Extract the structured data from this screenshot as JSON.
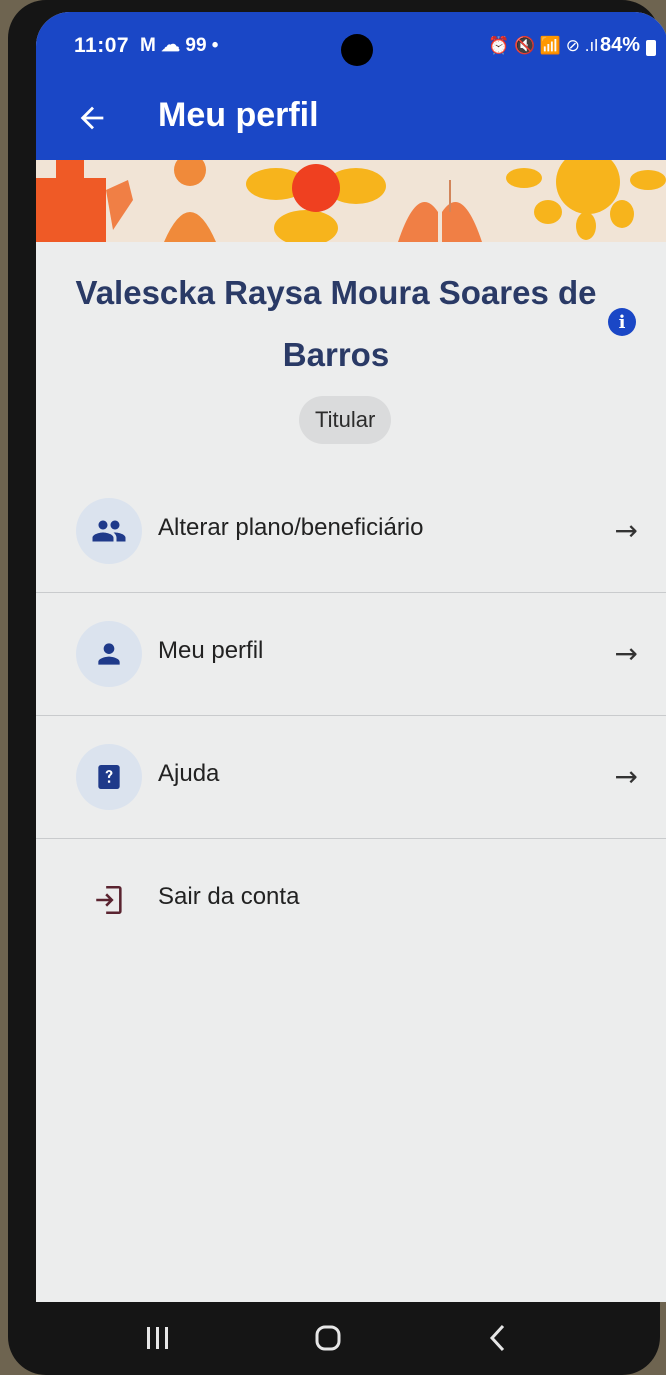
{
  "status_bar": {
    "time": "11:07",
    "left_icons": "M ☁ 99 •",
    "right_icons": "⏰ 🔇 📶 ⊘ .ıl",
    "battery": "84%"
  },
  "app_bar": {
    "title": "Meu perfil",
    "back_icon": "arrow-left-icon"
  },
  "profile": {
    "name": "Valescka Raysa Moura Soares de Barros",
    "badge": "Titular",
    "info_icon": "i"
  },
  "menu": {
    "items": [
      {
        "label": "Alterar plano/beneficiário",
        "icon": "group-icon",
        "arrow": "→"
      },
      {
        "label": "Meu perfil",
        "icon": "person-icon",
        "arrow": "→"
      },
      {
        "label": "Ajuda",
        "icon": "help-icon",
        "arrow": "→"
      },
      {
        "label": "Sair da conta",
        "icon": "logout-icon"
      }
    ]
  },
  "colors": {
    "primary": "#1a47c6",
    "text_dark": "#2a3a66",
    "background": "#eceded"
  }
}
